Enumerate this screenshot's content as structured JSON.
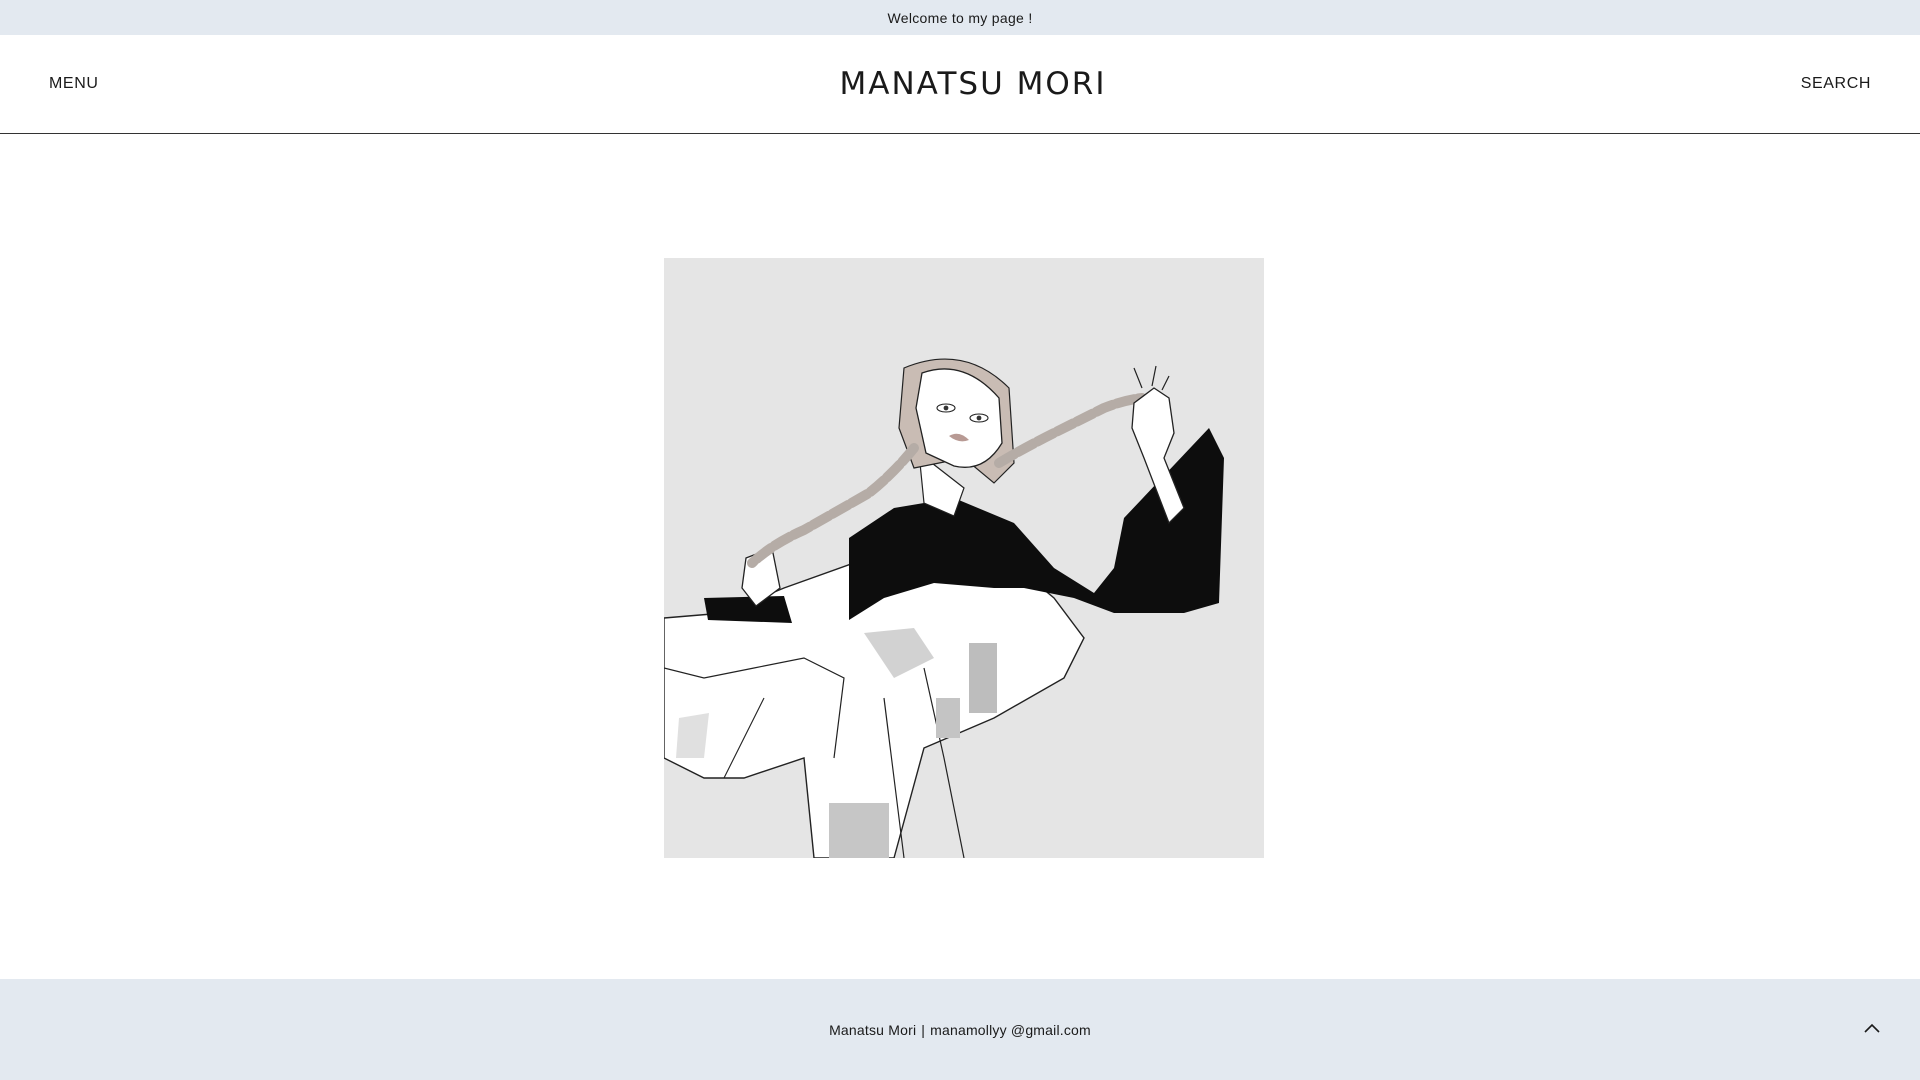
{
  "announcement": {
    "text": "Welcome to my page !"
  },
  "header": {
    "menu_label": "MENU",
    "site_title": "MANATSU MORI",
    "search_label": "SEARCH"
  },
  "main": {
    "artwork": {
      "icon": "illustration-image"
    }
  },
  "footer": {
    "name": "Manatsu Mori",
    "separator": "|",
    "email": "manamollyy @gmail.com",
    "to_top_icon": "chevron-up-icon"
  },
  "colors": {
    "band_background": "#e3e9f0",
    "artwork_background": "#e5e5e5",
    "text": "#1a1a1a"
  }
}
